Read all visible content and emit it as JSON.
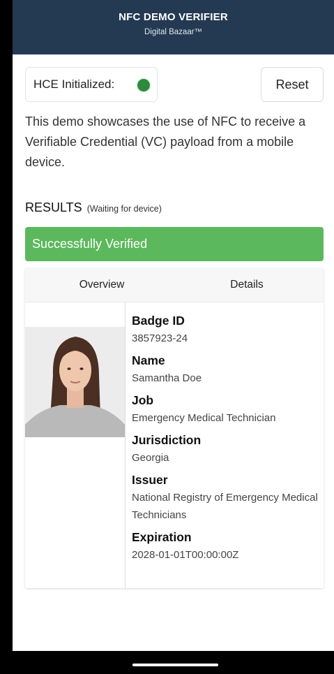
{
  "header": {
    "title": "NFC DEMO VERIFIER",
    "subtitle": "Digital Bazaar™"
  },
  "hce": {
    "label": "HCE Initialized:",
    "status_color": "#2e8b3c"
  },
  "reset_label": "Reset",
  "intro_text": "This demo showcases the use of NFC to receive a Verifiable Credential (VC) payload from a mobile device.",
  "results": {
    "heading": "RESULTS",
    "status_note": "(Waiting for device)",
    "verified_message": "Successfully Verified",
    "verified_color": "#5cb85c"
  },
  "tabs": [
    {
      "label": "Overview"
    },
    {
      "label": "Details"
    }
  ],
  "credential": {
    "fields": [
      {
        "label": "Badge ID",
        "value": "3857923-24"
      },
      {
        "label": "Name",
        "value": "Samantha Doe"
      },
      {
        "label": "Job",
        "value": "Emergency Medical Technician"
      },
      {
        "label": "Jurisdiction",
        "value": "Georgia"
      },
      {
        "label": "Issuer",
        "value": "National Registry of Emergency Medical Technicians"
      },
      {
        "label": "Expiration",
        "value": "2028-01-01T00:00:00Z"
      }
    ]
  }
}
